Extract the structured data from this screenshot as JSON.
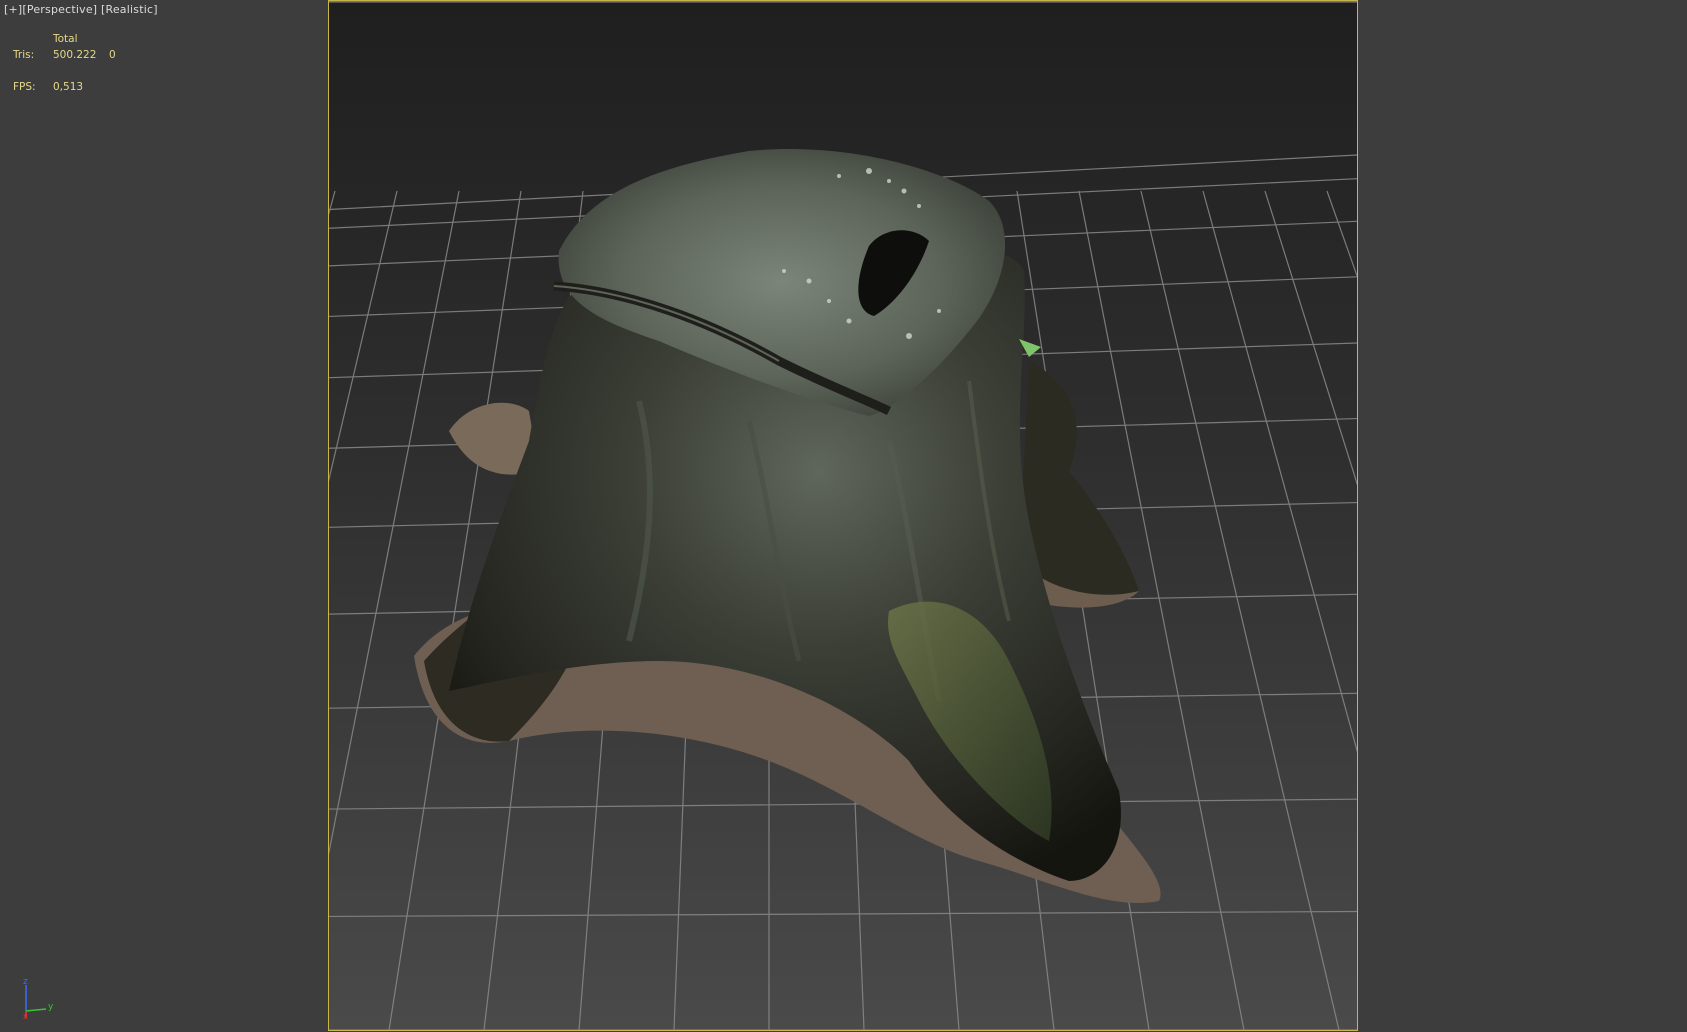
{
  "viewport": {
    "label_plus": "[+]",
    "label_view": "[Perspective]",
    "label_shading": "[Realistic]"
  },
  "stats": {
    "header": "Total",
    "tris_label": "Tris:",
    "tris_value": "500.222",
    "tris_selected": "0",
    "fps_label": "FPS:",
    "fps_value": "0,513"
  },
  "gizmo": {
    "x_label": "x",
    "y_label": "y",
    "z_label": "z"
  },
  "colors": {
    "viewport_bg": "#3d3d3d",
    "stats_text": "#e6d88a",
    "safe_frame": "#c9b64a",
    "grid_line": "#8a8a8a"
  },
  "icons": {
    "axis_gizmo": "axis-tripod-icon"
  }
}
